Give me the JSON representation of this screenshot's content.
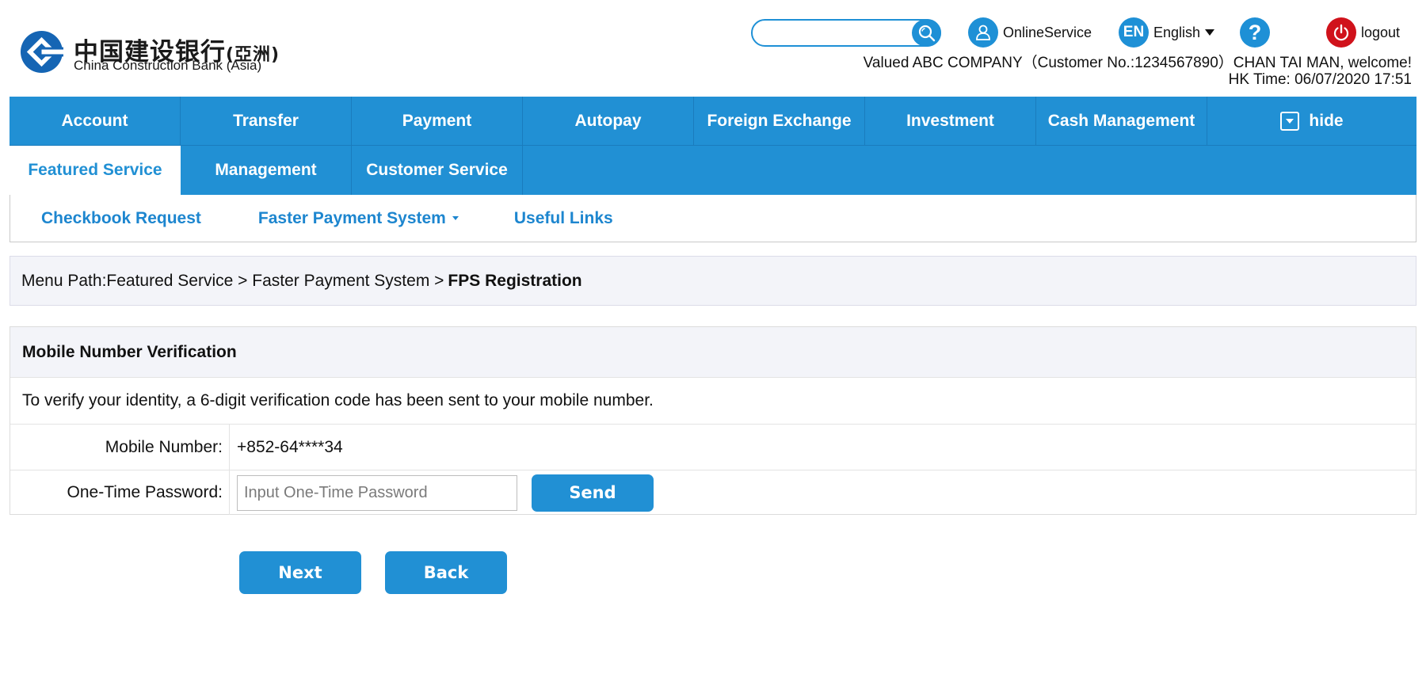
{
  "brand": {
    "cn_name": "中国建设银行",
    "cn_suffix": "(亞洲)",
    "en_name": "China Construction Bank (Asia)",
    "logo_icon": "ccb-logo-icon"
  },
  "header": {
    "search": {
      "value": "",
      "placeholder": "",
      "icon": "search-icon"
    },
    "online_service": {
      "label": "OnlineService",
      "icon": "user-icon"
    },
    "language": {
      "badge": "EN",
      "label": "English",
      "icon": "chevron-down-icon"
    },
    "help": {
      "glyph": "?",
      "icon": "help-icon"
    },
    "logout": {
      "label": "logout",
      "icon": "power-icon"
    },
    "welcome": "Valued ABC COMPANY（Customer No.:1234567890）CHAN TAI MAN, welcome!",
    "hk_time": "HK Time: 06/07/2020 17:51"
  },
  "colors": {
    "primary": "#2190d4",
    "logout": "#d0121b",
    "breadcrumb_bg": "#f3f4f9"
  },
  "nav": {
    "row1": [
      "Account",
      "Transfer",
      "Payment",
      "Autopay",
      "Foreign Exchange",
      "Investment",
      "Cash Management"
    ],
    "hide_label": "hide",
    "row2": [
      "Featured Service",
      "Management",
      "Customer Service"
    ],
    "active": "Featured Service"
  },
  "subnav": [
    {
      "label": "Checkbook Request"
    },
    {
      "label": "Faster Payment System"
    },
    {
      "label": "Useful Links"
    }
  ],
  "breadcrumb": {
    "prefix": "Menu Path:Featured Service > Faster Payment System >",
    "current": "FPS Registration"
  },
  "panel": {
    "title": "Mobile Number Verification",
    "note": "To verify your identity, a 6-digit verification code has been sent to your mobile number.",
    "mobile_label": "Mobile Number:",
    "mobile_value": "+852-64****34",
    "otp_label": "One-Time Password:",
    "otp_value": "",
    "otp_placeholder": "Input One-Time Password",
    "send_label": "Send"
  },
  "actions": {
    "next_label": "Next",
    "back_label": "Back"
  }
}
